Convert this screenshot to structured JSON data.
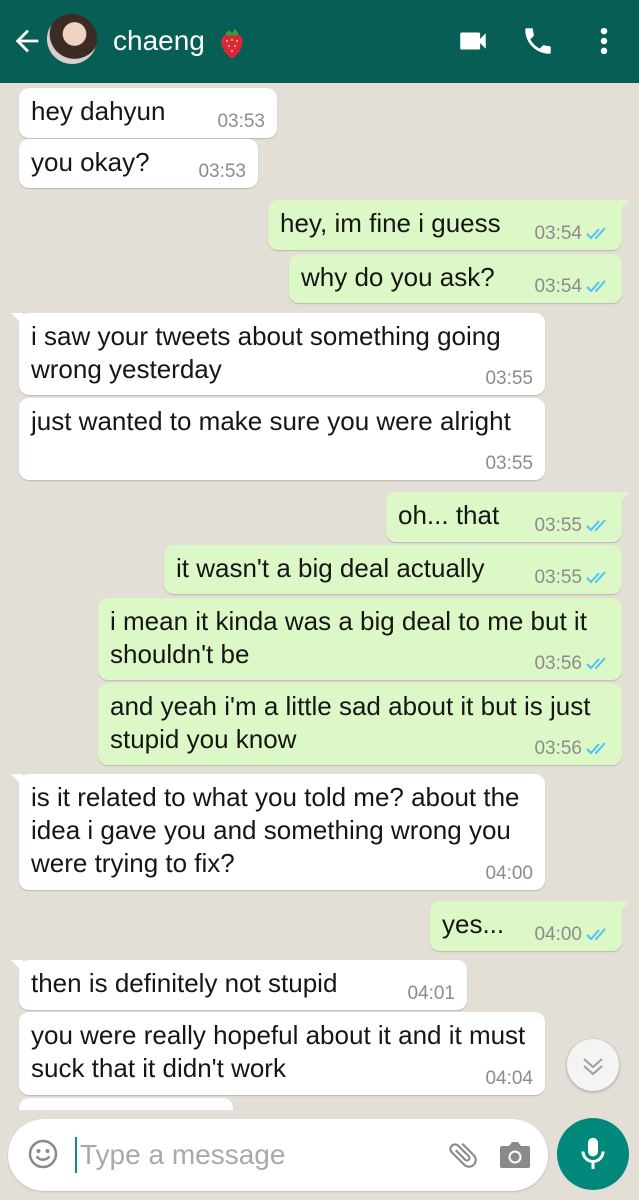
{
  "header": {
    "contact_name": "chaeng",
    "name_emoji": "strawberry-emoji",
    "bar_color": "#075e54",
    "icons": [
      "back-arrow-icon",
      "video-call-icon",
      "phone-icon",
      "more-options-icon"
    ]
  },
  "colors": {
    "incoming_bubble": "#ffffff",
    "outgoing_bubble": "#dcf8c6",
    "chat_background": "#e3dfd7",
    "read_ticks": "#4fc3f7",
    "mic_button": "#00897b"
  },
  "messages": [
    {
      "text": "hey dahyun",
      "time": "03:53"
    },
    {
      "text": "you okay?",
      "time": "03:53"
    },
    {
      "text": "hey, im fine i guess",
      "time": "03:54"
    },
    {
      "text": "why do you ask?",
      "time": "03:54"
    },
    {
      "text": "i saw your tweets about something going wrong yesterday",
      "time": "03:55"
    },
    {
      "text": "just wanted to make sure you were alright",
      "time": "03:55"
    },
    {
      "text": "oh... that",
      "time": "03:55"
    },
    {
      "text": "it wasn't a big deal actually",
      "time": "03:55"
    },
    {
      "text": "i mean it kinda was a big deal to me but it shouldn't be",
      "time": "03:56"
    },
    {
      "text": "and yeah i'm a little sad about it but is just stupid you know",
      "time": "03:56"
    },
    {
      "text": "is it related to what you told me? about the idea i gave you and something wrong you were trying to fix?",
      "time": "04:00"
    },
    {
      "text": "yes...",
      "time": "04:00"
    },
    {
      "text": "then is definitely not stupid",
      "time": "04:01"
    },
    {
      "text": "you were really hopeful about it and it must suck that it didn't work",
      "time": "04:04"
    }
  ],
  "composer": {
    "placeholder": "Type a message",
    "icons": [
      "emoji-icon",
      "attach-icon",
      "camera-icon",
      "mic-icon"
    ]
  },
  "scroll_down_icon": "chevron-down-icon"
}
